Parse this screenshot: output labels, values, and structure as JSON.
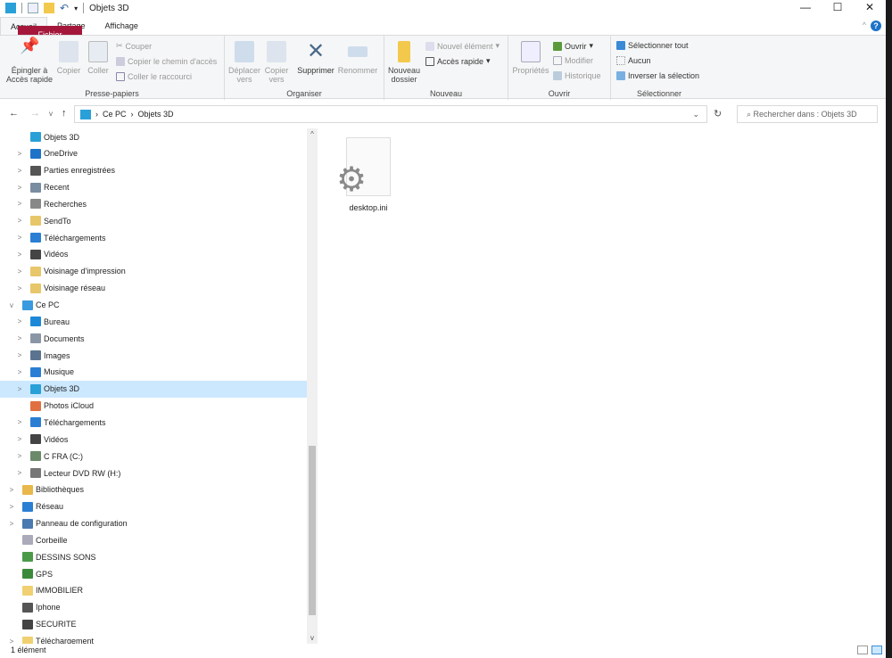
{
  "window": {
    "title": "Objets 3D",
    "minimize": "—",
    "maximize": "☐",
    "close": "✕"
  },
  "tabs": [
    "Fichier",
    "Accueil",
    "Partage",
    "Affichage"
  ],
  "ribbon": {
    "presse_papiers": {
      "label": "Presse-papiers",
      "pin": "Épingler à Accès rapide",
      "copy": "Copier",
      "paste": "Coller",
      "cut": "Couper",
      "copy_path": "Copier le chemin d'accès",
      "paste_shortcut": "Coller le raccourci"
    },
    "organiser": {
      "label": "Organiser",
      "move": "Déplacer vers",
      "copy_to": "Copier vers",
      "delete": "Supprimer",
      "rename": "Renommer"
    },
    "nouveau": {
      "label": "Nouveau",
      "new_folder": "Nouveau dossier",
      "new_item": "Nouvel élément",
      "quick_access": "Accès rapide"
    },
    "ouvrir": {
      "label": "Ouvrir",
      "properties": "Propriétés",
      "open": "Ouvrir",
      "edit": "Modifier",
      "history": "Historique"
    },
    "selectionner": {
      "label": "Sélectionner",
      "all": "Sélectionner tout",
      "none": "Aucun",
      "invert": "Inverser la sélection"
    }
  },
  "address": {
    "path": [
      "Ce PC",
      "Objets 3D"
    ],
    "search_placeholder": "Rechercher dans : Objets 3D"
  },
  "nav": [
    {
      "label": "Objets 3D",
      "level": 2,
      "chev": "",
      "color": "#2aa0d8"
    },
    {
      "label": "OneDrive",
      "level": 2,
      "chev": ">",
      "color": "#1e73c8"
    },
    {
      "label": "Parties enregistrées",
      "level": 2,
      "chev": ">",
      "color": "#555"
    },
    {
      "label": "Recent",
      "level": 2,
      "chev": ">",
      "color": "#7a8ca0"
    },
    {
      "label": "Recherches",
      "level": 2,
      "chev": ">",
      "color": "#888"
    },
    {
      "label": "SendTo",
      "level": 2,
      "chev": ">",
      "color": "#e8c66a"
    },
    {
      "label": "Téléchargements",
      "level": 2,
      "chev": ">",
      "color": "#2a7fd4"
    },
    {
      "label": "Vidéos",
      "level": 2,
      "chev": ">",
      "color": "#444"
    },
    {
      "label": "Voisinage d'impression",
      "level": 2,
      "chev": ">",
      "color": "#e8c66a"
    },
    {
      "label": "Voisinage réseau",
      "level": 2,
      "chev": ">",
      "color": "#e8c66a"
    },
    {
      "label": "Ce PC",
      "level": 1,
      "chev": "v",
      "color": "#3a9ae0"
    },
    {
      "label": "Bureau",
      "level": 2,
      "chev": ">",
      "color": "#1e88d8"
    },
    {
      "label": "Documents",
      "level": 2,
      "chev": ">",
      "color": "#8a96a6"
    },
    {
      "label": "Images",
      "level": 2,
      "chev": ">",
      "color": "#5a7490"
    },
    {
      "label": "Musique",
      "level": 2,
      "chev": ">",
      "color": "#2a7fd4"
    },
    {
      "label": "Objets 3D",
      "level": 2,
      "chev": ">",
      "color": "#2aa0d8",
      "selected": true
    },
    {
      "label": "Photos iCloud",
      "level": 2,
      "chev": "",
      "color": "#e07040"
    },
    {
      "label": "Téléchargements",
      "level": 2,
      "chev": ">",
      "color": "#2a7fd4"
    },
    {
      "label": "Vidéos",
      "level": 2,
      "chev": ">",
      "color": "#444"
    },
    {
      "label": "C FRA (C:)",
      "level": 2,
      "chev": ">",
      "color": "#6a8a6a"
    },
    {
      "label": "Lecteur DVD RW (H:)",
      "level": 2,
      "chev": ">",
      "color": "#777"
    },
    {
      "label": "Bibliothèques",
      "level": 1,
      "chev": ">",
      "color": "#e8b84a"
    },
    {
      "label": "Réseau",
      "level": 1,
      "chev": ">",
      "color": "#2a7fd4"
    },
    {
      "label": "Panneau de configuration",
      "level": 1,
      "chev": ">",
      "color": "#4a7ab0"
    },
    {
      "label": "Corbeille",
      "level": 1,
      "chev": "",
      "color": "#aab"
    },
    {
      "label": "DESSINS SONS",
      "level": 1,
      "chev": "",
      "color": "#4a9a4a"
    },
    {
      "label": "GPS",
      "level": 1,
      "chev": "",
      "color": "#3a8a3a"
    },
    {
      "label": "IMMOBILIER",
      "level": 1,
      "chev": "",
      "color": "#f0d070"
    },
    {
      "label": "Iphone",
      "level": 1,
      "chev": "",
      "color": "#555"
    },
    {
      "label": "SECURITE",
      "level": 1,
      "chev": "",
      "color": "#444"
    },
    {
      "label": "Téléchargement",
      "level": 1,
      "chev": ">",
      "color": "#f0d070"
    }
  ],
  "files": [
    {
      "name": "desktop.ini",
      "icon": "settings-file-icon"
    }
  ],
  "status": {
    "count": "1 élément"
  }
}
